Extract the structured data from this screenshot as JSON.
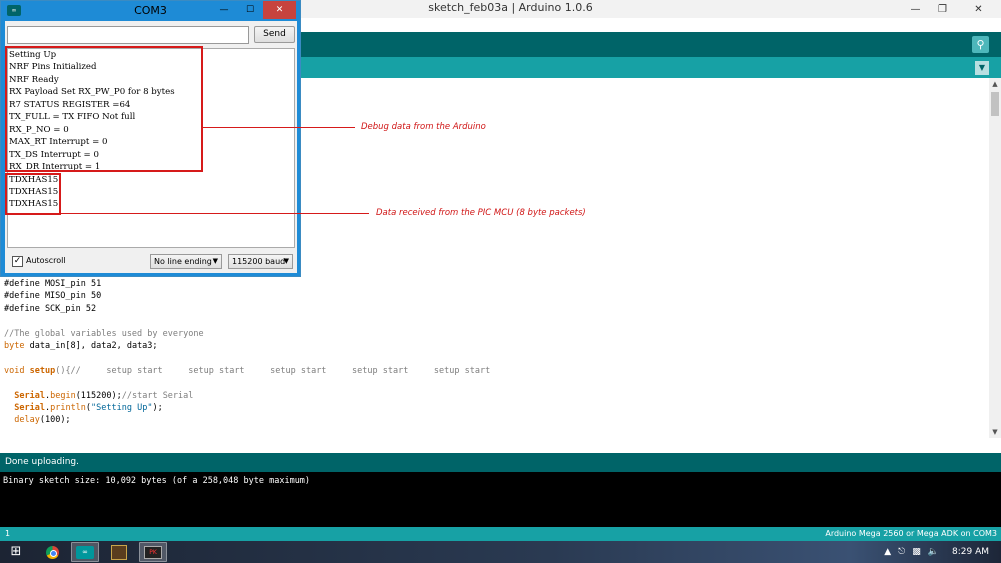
{
  "main_window": {
    "title": "sketch_feb03a | Arduino 1.0.6",
    "minimize_icon": "minimize-icon",
    "maximize_icon": "restore-icon",
    "close_icon": "close-icon"
  },
  "editor": {
    "lines": [
      {
        "parts": [
          {
            "t": "#define MOSI_pin 51",
            "c": ""
          }
        ]
      },
      {
        "parts": [
          {
            "t": "#define MISO_pin 50",
            "c": ""
          }
        ]
      },
      {
        "parts": [
          {
            "t": "#define SCK_pin 52",
            "c": ""
          }
        ]
      },
      {
        "parts": [
          {
            "t": "",
            "c": ""
          }
        ]
      },
      {
        "parts": [
          {
            "t": "//The global variables used by everyone",
            "c": "cmt"
          }
        ]
      },
      {
        "parts": [
          {
            "t": "byte",
            "c": "kw"
          },
          {
            "t": " data_in[8], data2, data3;",
            "c": ""
          }
        ]
      },
      {
        "parts": [
          {
            "t": "",
            "c": ""
          }
        ]
      },
      {
        "parts": [
          {
            "t": "void",
            "c": "kw"
          },
          {
            "t": " ",
            "c": ""
          },
          {
            "t": "setup",
            "c": "fn"
          },
          {
            "t": "(){//     setup start     setup start     setup start     setup start     setup start",
            "c": "cmt"
          }
        ]
      },
      {
        "parts": [
          {
            "t": "",
            "c": ""
          }
        ]
      },
      {
        "parts": [
          {
            "t": "  ",
            "c": ""
          },
          {
            "t": "Serial",
            "c": "fn"
          },
          {
            "t": ".",
            "c": ""
          },
          {
            "t": "begin",
            "c": "kw"
          },
          {
            "t": "(115200);",
            "c": ""
          },
          {
            "t": "//start Serial",
            "c": "cmt"
          }
        ]
      },
      {
        "parts": [
          {
            "t": "  ",
            "c": ""
          },
          {
            "t": "Serial",
            "c": "fn"
          },
          {
            "t": ".",
            "c": ""
          },
          {
            "t": "println",
            "c": "kw"
          },
          {
            "t": "(",
            "c": ""
          },
          {
            "t": "\"Setting Up\"",
            "c": "str"
          },
          {
            "t": ");",
            "c": ""
          }
        ]
      },
      {
        "parts": [
          {
            "t": "  ",
            "c": ""
          },
          {
            "t": "delay",
            "c": "kw"
          },
          {
            "t": "(100);",
            "c": ""
          }
        ]
      }
    ]
  },
  "status": {
    "message": "Done uploading."
  },
  "console": {
    "text": "Binary sketch size: 10,092 bytes (of a 258,048 byte maximum)"
  },
  "footer": {
    "line_number": "1",
    "board": "Arduino Mega 2560 or Mega ADK on COM3"
  },
  "serial_monitor": {
    "title": "COM3",
    "input_value": "",
    "send_label": "Send",
    "output_lines": [
      "Setting Up",
      "NRF Pins Initialized",
      "NRF Ready",
      "RX Payload Set RX_PW_P0 for 8 bytes",
      "R7 STATUS REGISTER  =64",
      "TX_FULL = TX FIFO Not full",
      "RX_P_NO = 0",
      "MAX_RT Interrupt = 0",
      "TX_DS Interrupt = 0",
      "RX_DR Interrupt = 1",
      "TDXHAS15",
      "TDXHAS15",
      "TDXHAS15"
    ],
    "autoscroll_label": "Autoscroll",
    "autoscroll_checked": true,
    "line_ending": "No line ending",
    "baud": "115200 baud"
  },
  "annotations": {
    "debug_label": "Debug data from the Arduino",
    "pic_label": "Data received from the PIC MCU (8 byte packets)",
    "color": "#d61a1a"
  },
  "taskbar": {
    "time": "8:29 AM",
    "apps": [
      "chrome-icon",
      "arduino-icon",
      "mplab-icon",
      "pickit-icon"
    ]
  }
}
